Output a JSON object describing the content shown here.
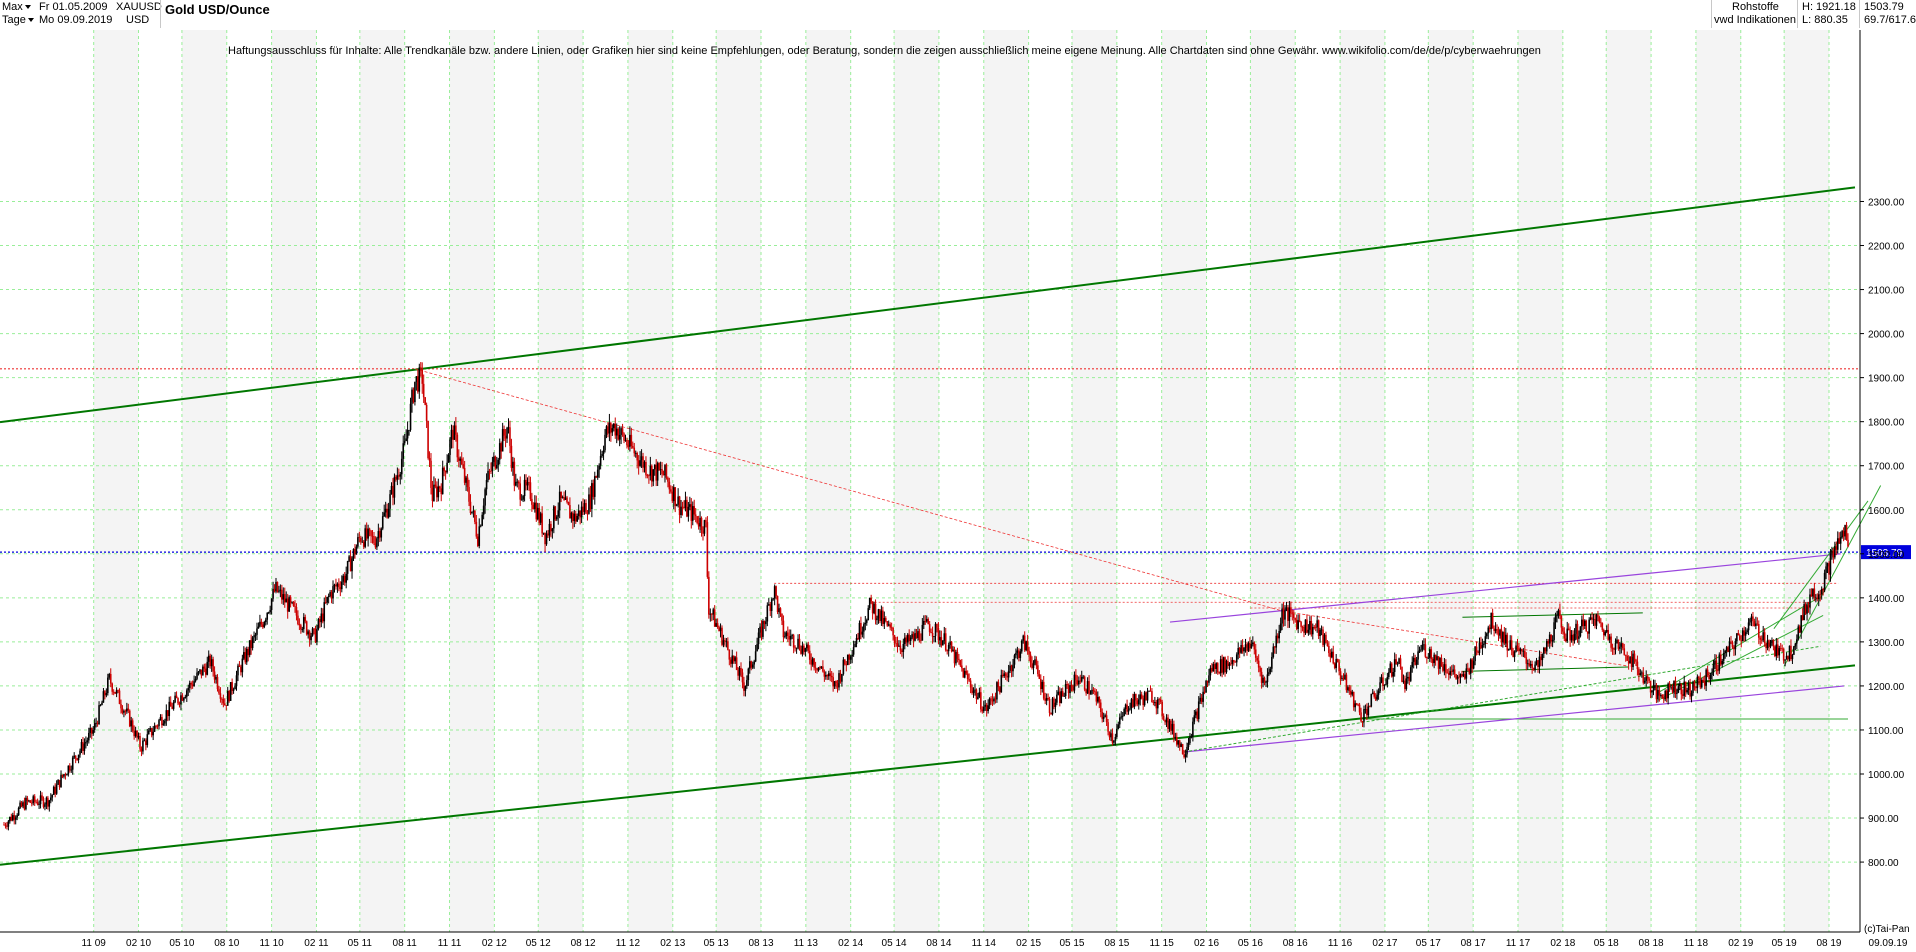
{
  "header": {
    "range_select": "Max",
    "interval_select": "Tage",
    "date_from": "Fr 01.05.2009",
    "date_to": "Mo 09.09.2019",
    "symbol": "XAUUSD",
    "currency": "USD",
    "title": "Gold USD/Ounce",
    "category": "Rohstoffe",
    "source": "vwd Indikationen",
    "high": "H: 1921.18",
    "low": "L: 880.35",
    "last": "1503.79",
    "change": "69.7/617.6"
  },
  "disclaimer": "Haftungsausschluss für Inhalte: Alle Trendkanäle bzw. andere Linien, oder Grafiken hier sind keine Empfehlungen, oder Beratung, sondern die zeigen ausschließlich meine eigene Meinung. Alle Chartdaten sind ohne Gewähr.  www.wikifolio.com/de/de/p/cyberwaehrungen",
  "copyright": "(c)Tai-Pan",
  "colors": {
    "price": "#cc0000",
    "candle_up": "#000000",
    "grid": "#99ee99",
    "channel": "#007700",
    "trend_green": "#33aa33",
    "purple": "#9944dd",
    "red_dotted": "#ee3333",
    "last_line": "#0000dd"
  },
  "chart_data": {
    "type": "line",
    "title": "Gold USD/Ounce",
    "xlabel": "",
    "ylabel": "",
    "ylim": [
      720,
      2360
    ],
    "y_ticks": [
      "800.00",
      "900.00",
      "1000.00",
      "1100.00",
      "1200.00",
      "1300.00",
      "1400.00",
      "1500.00",
      "1600.00",
      "1700.00",
      "1800.00",
      "1900.00",
      "2000.00",
      "2100.00",
      "2200.00",
      "2300.00"
    ],
    "x_ticks": [
      "11 09",
      "02 10",
      "05 10",
      "08 10",
      "11 10",
      "02 11",
      "05 11",
      "08 11",
      "11 11",
      "02 12",
      "05 12",
      "08 12",
      "11 12",
      "02 13",
      "05 13",
      "08 13",
      "11 13",
      "02 14",
      "05 14",
      "08 14",
      "11 14",
      "02 15",
      "05 15",
      "08 15",
      "11 15",
      "02 16",
      "05 16",
      "08 16",
      "11 16",
      "02 17",
      "05 17",
      "08 17",
      "11 17",
      "02 18",
      "05 18",
      "08 18",
      "11 18",
      "02 19",
      "05 19",
      "08 19"
    ],
    "x_end_label": "09.09.19",
    "last_value_label": "1503.79",
    "series": [
      {
        "name": "XAUUSD",
        "x": [
          "2009-05-01",
          "2009-06-15",
          "2009-08-01",
          "2009-09-01",
          "2009-10-01",
          "2009-11-01",
          "2009-12-03",
          "2010-01-15",
          "2010-02-05",
          "2010-03-15",
          "2010-05-01",
          "2010-06-28",
          "2010-07-28",
          "2010-09-01",
          "2010-10-15",
          "2010-11-09",
          "2011-01-28",
          "2011-03-01",
          "2011-04-01",
          "2011-05-02",
          "2011-06-01",
          "2011-07-01",
          "2011-08-01",
          "2011-08-22",
          "2011-09-06",
          "2011-09-26",
          "2011-10-15",
          "2011-11-08",
          "2011-12-29",
          "2012-01-15",
          "2012-02-28",
          "2012-03-15",
          "2012-04-15",
          "2012-05-16",
          "2012-06-15",
          "2012-07-15",
          "2012-08-15",
          "2012-09-15",
          "2012-10-04",
          "2012-11-15",
          "2012-12-15",
          "2013-01-15",
          "2013-02-15",
          "2013-03-15",
          "2013-04-10",
          "2013-04-15",
          "2013-06-28",
          "2013-08-28",
          "2013-09-15",
          "2013-10-15",
          "2013-12-31",
          "2014-03-14",
          "2014-05-15",
          "2014-06-15",
          "2014-07-10",
          "2014-08-15",
          "2014-09-15",
          "2014-11-05",
          "2015-01-22",
          "2015-02-15",
          "2015-03-17",
          "2015-05-15",
          "2015-06-15",
          "2015-07-24",
          "2015-08-24",
          "2015-10-14",
          "2015-12-17",
          "2016-02-11",
          "2016-03-15",
          "2016-05-02",
          "2016-05-31",
          "2016-07-06",
          "2016-08-15",
          "2016-09-15",
          "2016-10-15",
          "2016-12-15",
          "2017-02-27",
          "2017-03-15",
          "2017-04-17",
          "2017-07-10",
          "2017-09-08",
          "2017-10-15",
          "2017-12-12",
          "2018-01-25",
          "2018-02-08",
          "2018-04-11",
          "2018-05-15",
          "2018-06-15",
          "2018-08-16",
          "2018-09-15",
          "2018-10-15",
          "2018-11-15",
          "2018-12-15",
          "2019-01-15",
          "2019-02-20",
          "2019-04-23",
          "2019-05-15",
          "2019-06-25",
          "2019-07-15",
          "2019-08-13",
          "2019-09-04",
          "2019-09-09"
        ],
        "y": [
          885,
          935,
          940,
          1000,
          1050,
          1100,
          1215,
          1120,
          1060,
          1120,
          1180,
          1255,
          1160,
          1250,
          1350,
          1420,
          1310,
          1410,
          1450,
          1540,
          1530,
          1620,
          1740,
          1890,
          1900,
          1630,
          1660,
          1780,
          1540,
          1660,
          1790,
          1650,
          1640,
          1540,
          1620,
          1580,
          1620,
          1770,
          1790,
          1730,
          1690,
          1680,
          1610,
          1590,
          1560,
          1380,
          1200,
          1420,
          1320,
          1300,
          1200,
          1385,
          1290,
          1310,
          1340,
          1300,
          1240,
          1145,
          1300,
          1240,
          1150,
          1220,
          1180,
          1080,
          1160,
          1180,
          1050,
          1240,
          1250,
          1300,
          1200,
          1370,
          1340,
          1330,
          1270,
          1130,
          1260,
          1200,
          1290,
          1210,
          1350,
          1290,
          1240,
          1360,
          1310,
          1350,
          1300,
          1270,
          1175,
          1200,
          1190,
          1210,
          1250,
          1290,
          1345,
          1270,
          1280,
          1410,
          1420,
          1510,
          1555,
          1503.79
        ]
      }
    ],
    "horizontal_levels": [
      1503.79,
      1920,
      1433,
      1390,
      1377,
      1125
    ],
    "lines": [
      {
        "name": "upper channel",
        "x1": "2009-05-01",
        "y1": 1800,
        "x2": "2019-09-09",
        "y2": 2330
      },
      {
        "name": "lower channel",
        "x1": "2009-05-01",
        "y1": 795,
        "x2": "2019-09-09",
        "y2": 1245
      },
      {
        "name": "resistance purple",
        "x1": "2015-12-17",
        "y1": 1345,
        "x2": "2019-08-25",
        "y2": 1500
      },
      {
        "name": "support purple",
        "x1": "2018-08-16",
        "y1": 1160,
        "x2": "2019-09-01",
        "y2": 1200
      },
      {
        "name": "downtrend",
        "x1": "2011-08-22",
        "y1": 1920,
        "x2": "2016-07-06",
        "y2": 1370
      }
    ]
  }
}
